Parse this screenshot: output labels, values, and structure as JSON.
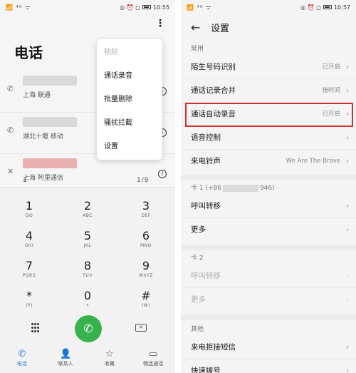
{
  "left": {
    "status": {
      "signal": "📶 ⁴ᴳ ᯤ",
      "icons": "◎ ⏰ ◻",
      "battery_pct": 0.8,
      "time": "10:55"
    },
    "title": "电话",
    "calls": [
      {
        "sub": "上海 联通"
      },
      {
        "sub": "湖北十堰 移动"
      },
      {
        "sub": "上海 阿里通信"
      }
    ],
    "partial_row": {
      "text": "1",
      "meta": "1/9"
    },
    "menu": {
      "items": [
        {
          "label": "粘贴",
          "disabled": true
        },
        {
          "label": "通话录音"
        },
        {
          "label": "批量删除"
        },
        {
          "label": "骚扰拦截"
        },
        {
          "label": "设置"
        }
      ]
    },
    "dialpad": {
      "keys": [
        {
          "num": "1",
          "letters": "QO"
        },
        {
          "num": "2",
          "letters": "ABC"
        },
        {
          "num": "3",
          "letters": "DEF"
        },
        {
          "num": "4",
          "letters": "GHI"
        },
        {
          "num": "5",
          "letters": "JKL"
        },
        {
          "num": "6",
          "letters": "MNO"
        },
        {
          "num": "7",
          "letters": "PQRS"
        },
        {
          "num": "8",
          "letters": "TUV"
        },
        {
          "num": "9",
          "letters": "WXYZ"
        },
        {
          "num": "*",
          "letters": "(P)"
        },
        {
          "num": "0",
          "letters": "+"
        },
        {
          "num": "#",
          "letters": "(W)"
        }
      ]
    },
    "nav": [
      {
        "label": "电话",
        "icon": "phone-icon",
        "glyph": "✆"
      },
      {
        "label": "联系人",
        "icon": "contacts-icon",
        "glyph": "👤"
      },
      {
        "label": "收藏",
        "icon": "star-icon",
        "glyph": "☆"
      },
      {
        "label": "畅连通话",
        "icon": "video-call-icon",
        "glyph": "▭"
      }
    ]
  },
  "right": {
    "status": {
      "signal": "📶 ⁴ᴳ ᯤ",
      "icons": "◎ ⏰ ◻",
      "battery_pct": 0.8,
      "time": "10:57"
    },
    "title": "设置",
    "sections": {
      "common_label": "常用",
      "common": [
        {
          "label": "陌生号码识别",
          "value": "已开启"
        },
        {
          "label": "通话记录合并",
          "value": "按时间"
        },
        {
          "label": "通话自动录音",
          "value": "已开启"
        },
        {
          "label": "语音控制",
          "value": ""
        },
        {
          "label": "来电铃声",
          "value": "We Are The Brave"
        }
      ],
      "card1_label_prefix": "卡 1 (+86",
      "card1_label_suffix": "946)",
      "card1": [
        {
          "label": "呼叫转移"
        },
        {
          "label": "更多"
        }
      ],
      "card2_label": "卡 2",
      "card2": [
        {
          "label": "呼叫转移"
        },
        {
          "label": "更多"
        }
      ],
      "other_label": "其他",
      "other": [
        {
          "label": "来电拒接短信"
        },
        {
          "label": "快速拨号"
        }
      ]
    }
  }
}
